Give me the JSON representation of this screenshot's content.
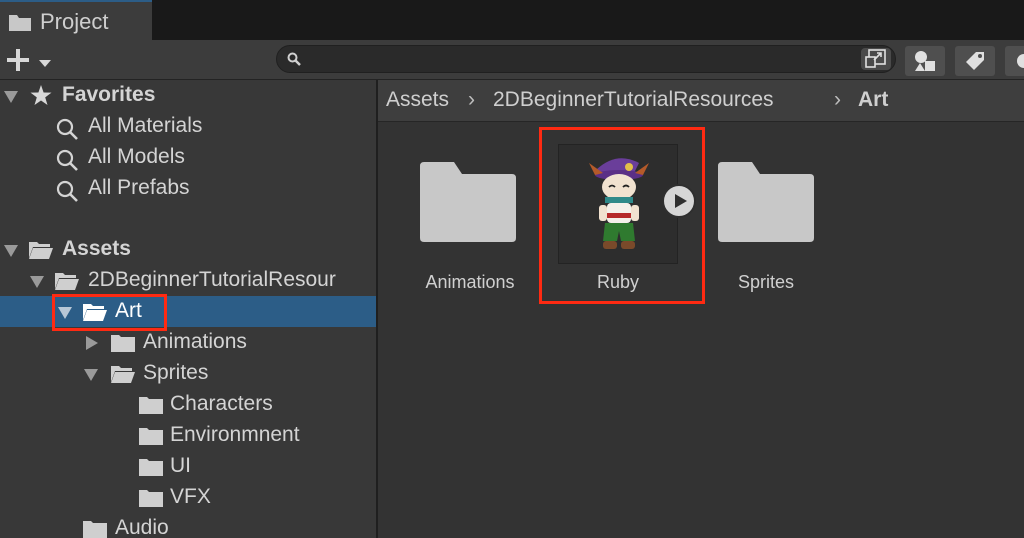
{
  "tab": {
    "label": "Project"
  },
  "search": {
    "placeholder": "",
    "value": ""
  },
  "colors": {
    "selection": "#2c5d87",
    "highlight": "#ff2a12",
    "folder": "#c8c8c8"
  },
  "tree": {
    "favorites": {
      "label": "Favorites",
      "items": [
        "All Materials",
        "All Models",
        "All Prefabs"
      ]
    },
    "assets": {
      "label": "Assets"
    },
    "resources": {
      "label": "2DBeginnerTutorialResour"
    },
    "art": {
      "label": "Art"
    },
    "animations": {
      "label": "Animations"
    },
    "sprites": {
      "label": "Sprites"
    },
    "characters": {
      "label": "Characters"
    },
    "environment": {
      "label": "Environmnent"
    },
    "ui": {
      "label": "UI"
    },
    "vfx": {
      "label": "VFX"
    },
    "audio": {
      "label": "Audio"
    }
  },
  "breadcrumb": [
    "Assets",
    "2DBeginnerTutorialResources",
    "Art"
  ],
  "grid": {
    "items": [
      {
        "label": "Animations",
        "icon": "folder-icon"
      },
      {
        "label": "Ruby",
        "icon": "sprite-thumbnail"
      },
      {
        "label": "Sprites",
        "icon": "folder-icon"
      }
    ]
  }
}
